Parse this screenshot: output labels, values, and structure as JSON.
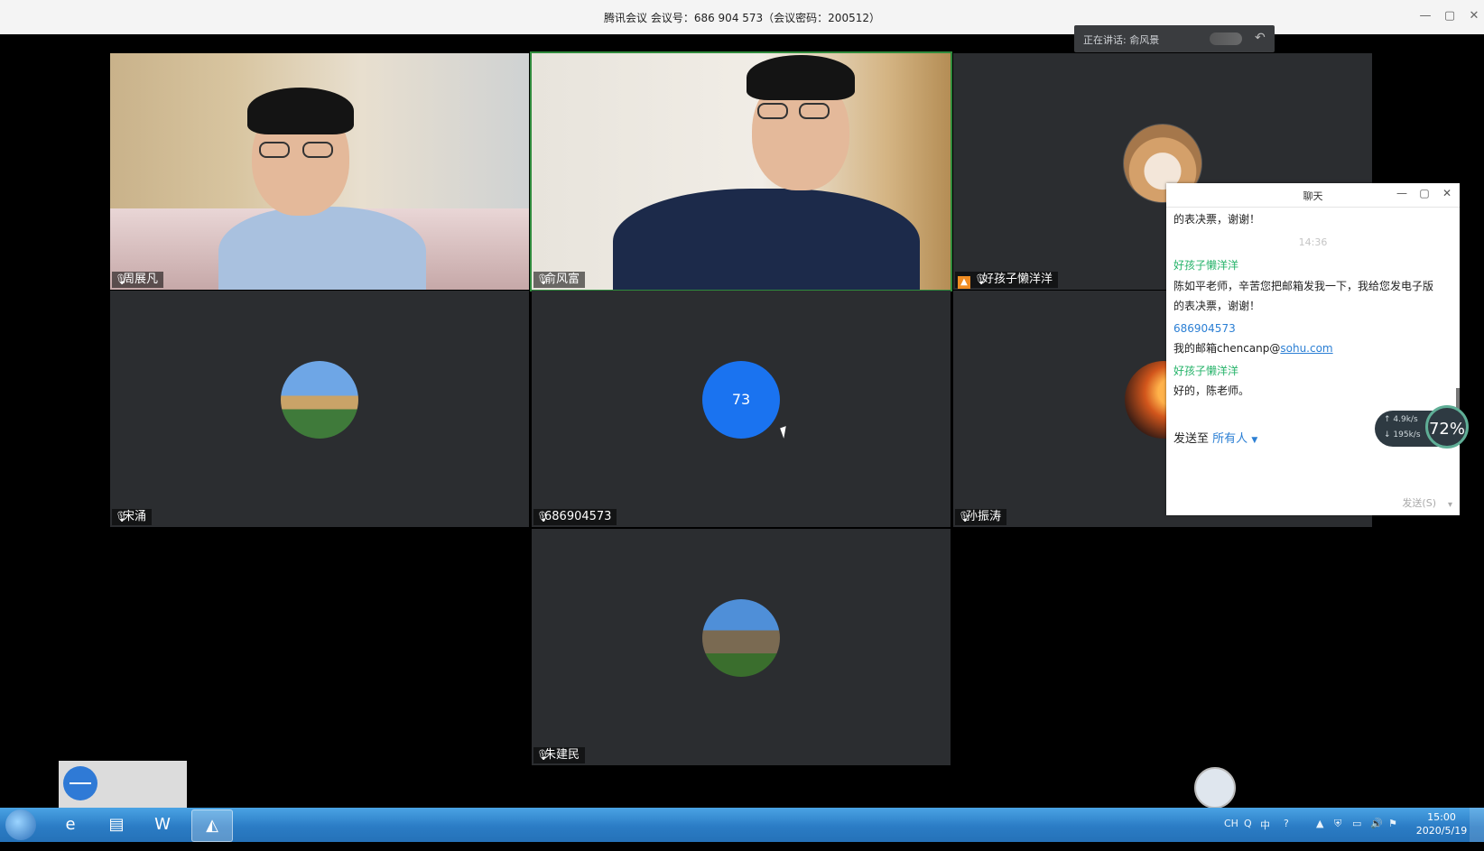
{
  "window": {
    "title": "腾讯会议 会议号：686 904 573（会议密码：200512）",
    "min_icon": "minimize-icon",
    "max_icon": "maximize-icon",
    "close_icon": "close-icon"
  },
  "speaking": {
    "label": "正在讲话: 俞风景"
  },
  "tiles": [
    {
      "name": "周展凡",
      "kind": "video"
    },
    {
      "name": "俞风富",
      "kind": "video",
      "active": true
    },
    {
      "name": "好孩子懒洋洋",
      "kind": "avatar",
      "host": true
    },
    {
      "name": "宋涌",
      "kind": "avatar"
    },
    {
      "name": "686904573",
      "kind": "number",
      "avatar_text": "73"
    },
    {
      "name": "孙振涛",
      "kind": "avatar"
    },
    {
      "name": "朱建民",
      "kind": "avatar"
    }
  ],
  "chat": {
    "title": "聊天",
    "lines": {
      "l1": "的表决票，谢谢！",
      "time": "14:36",
      "sender1": "好孩子懒洋洋",
      "msg1a": "陈如平老师，辛苦您把邮箱发我一下，我给您发电子版",
      "msg1b": "的表决票，谢谢！",
      "sender2": "686904573",
      "msg2_prefix": "我的邮箱chencanp@",
      "msg2_link": "sohu.com",
      "sender3": "好孩子懒洋洋",
      "msg3": "好的，陈老师。"
    },
    "send_to_label": "发送至",
    "send_to_target": "所有人",
    "send_button": "发送(S)"
  },
  "network": {
    "up": "4.9k/s",
    "down": "195k/s",
    "value": "72%"
  },
  "taskbar": {
    "apps": [
      "start-orb",
      "internet-explorer",
      "file-explorer",
      "word",
      "tencent-meeting"
    ],
    "tray": [
      "CH",
      "Q",
      "中",
      "?",
      "▲"
    ],
    "clock_time": "15:00",
    "clock_date": "2020/5/19"
  },
  "colors": {
    "accent": "#2b7fd4",
    "sender_green": "#26b36a",
    "active_border": "#2f8a3c",
    "tile_bg": "#2b2d30"
  }
}
